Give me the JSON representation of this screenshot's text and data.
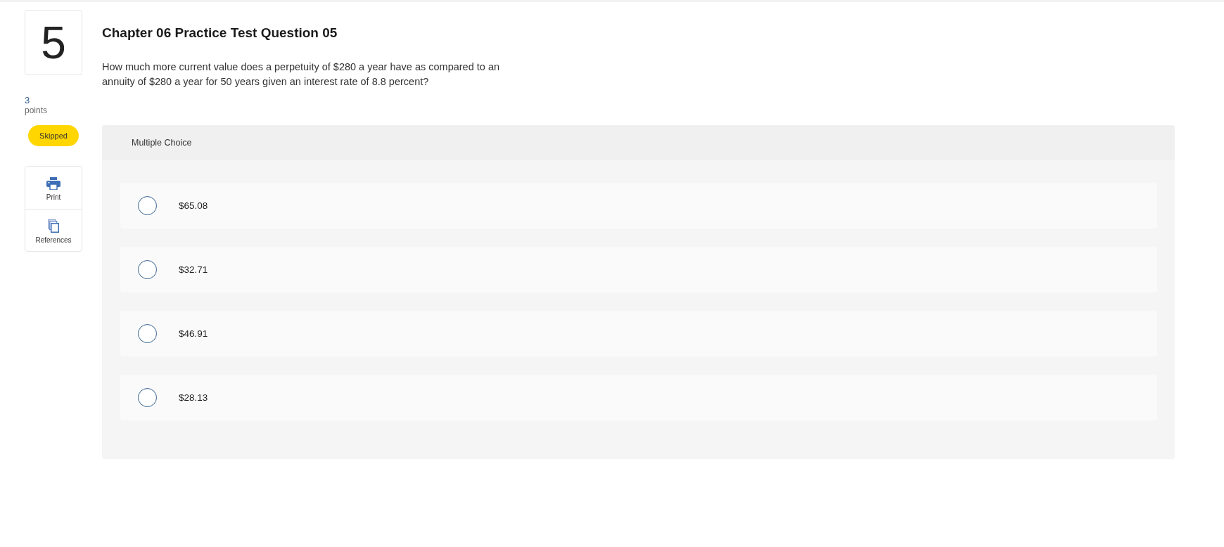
{
  "question": {
    "number": "5",
    "points": "3",
    "points_label": "points",
    "status": "Skipped",
    "title": "Chapter 06 Practice Test Question 05",
    "text": "How much more current value does a perpetuity of $280 a year have as compared to an annuity of $280 a year for 50 years given an interest rate of 8.8 percent?"
  },
  "tools": [
    {
      "kind": "print",
      "label": "Print"
    },
    {
      "kind": "references",
      "label": "References"
    }
  ],
  "answer": {
    "type_label": "Multiple Choice",
    "choices": [
      {
        "label": "$65.08",
        "selected": false
      },
      {
        "label": "$32.71",
        "selected": false
      },
      {
        "label": "$46.91",
        "selected": false
      },
      {
        "label": "$28.13",
        "selected": false
      }
    ]
  }
}
